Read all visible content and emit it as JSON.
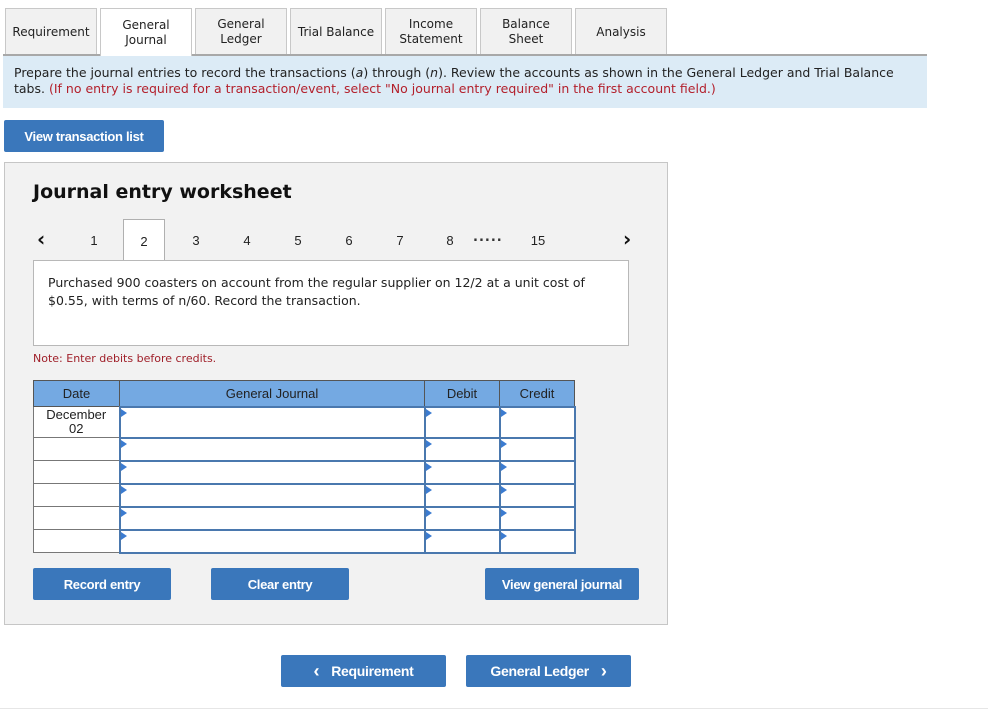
{
  "tabs": [
    {
      "label": "Requirement",
      "active": false
    },
    {
      "label": "General Journal",
      "active": true
    },
    {
      "label": "General Ledger",
      "active": false
    },
    {
      "label": "Trial Balance",
      "active": false
    },
    {
      "label": "Income Statement",
      "active": false
    },
    {
      "label": "Balance Sheet",
      "active": false
    },
    {
      "label": "Analysis",
      "active": false
    }
  ],
  "instructions": {
    "text_1": "Prepare the journal entries to record the transactions (",
    "a": "a",
    "text_2": ") through (",
    "n": "n",
    "text_3": "). Review the accounts as shown in the General Ledger and Trial Balance tabs. ",
    "red": "(If no entry is required for a transaction/event, select \"No journal entry required\" in the first account field.)"
  },
  "view_transaction_list": "View transaction list",
  "worksheet": {
    "title": "Journal entry worksheet",
    "prev_icon": "‹",
    "next_icon": "›",
    "pages": [
      "1",
      "2",
      "3",
      "4",
      "5",
      "6",
      "7",
      "8"
    ],
    "active_page": "2",
    "ellipsis": ".....",
    "last_page": "15",
    "description": "Purchased 900 coasters on account from the regular supplier on 12/2 at a unit cost of $0.55, with terms of n/60. Record the transaction.",
    "note": "Note: Enter debits before credits.",
    "table": {
      "headers": {
        "date": "Date",
        "account": "General Journal",
        "debit": "Debit",
        "credit": "Credit"
      },
      "rows": [
        {
          "date": "December\n02",
          "account": "",
          "debit": "",
          "credit": ""
        },
        {
          "date": "",
          "account": "",
          "debit": "",
          "credit": ""
        },
        {
          "date": "",
          "account": "",
          "debit": "",
          "credit": ""
        },
        {
          "date": "",
          "account": "",
          "debit": "",
          "credit": ""
        },
        {
          "date": "",
          "account": "",
          "debit": "",
          "credit": ""
        },
        {
          "date": "",
          "account": "",
          "debit": "",
          "credit": ""
        }
      ]
    },
    "record_entry": "Record entry",
    "clear_entry": "Clear entry",
    "view_general_journal": "View general journal"
  },
  "nav": {
    "prev_label": "Requirement",
    "next_label": "General Ledger",
    "prev_icon": "‹",
    "next_icon": "›"
  },
  "colors": {
    "button": "#3a77bb",
    "header": "#74a9e2",
    "instructions_bg": "#dcebf6",
    "note_red": "#b3202c"
  }
}
